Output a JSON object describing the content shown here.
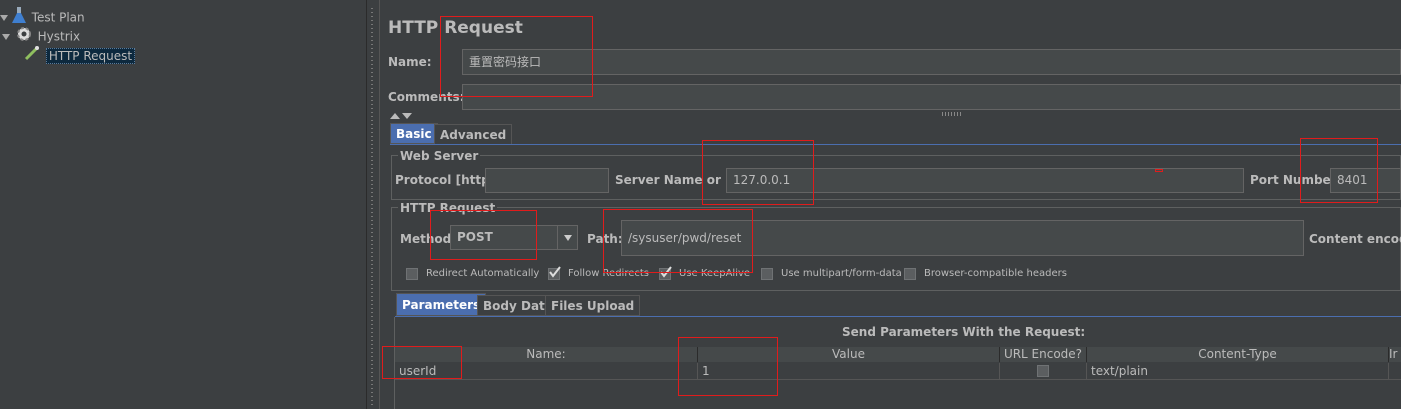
{
  "tree": {
    "items": [
      {
        "label": "Test Plan",
        "icon": "flask-icon"
      },
      {
        "label": "Hystrix",
        "icon": "gear-icon"
      },
      {
        "label": "HTTP Request",
        "icon": "pipette-icon"
      }
    ]
  },
  "editor": {
    "title": "HTTP Request",
    "name_label": "Name:",
    "name_value": "重置密码接口",
    "comments_label": "Comments:",
    "comments_value": "",
    "tabs": [
      "Basic",
      "Advanced"
    ],
    "web_server": {
      "legend": "Web Server",
      "protocol_label": "Protocol [http]:",
      "protocol_value": "",
      "server_label": "Server Name or IP:",
      "server_value": "127.0.0.1",
      "port_label": "Port Number:",
      "port_value": "8401"
    },
    "http_request": {
      "legend": "HTTP Request",
      "method_label": "Method:",
      "method_value": "POST",
      "path_label": "Path:",
      "path_value": "/sysuser/pwd/reset",
      "encoding_label": "Content encodin",
      "checkboxes": [
        {
          "label": "Redirect Automatically",
          "checked": false
        },
        {
          "label": "Follow Redirects",
          "checked": true
        },
        {
          "label": "Use KeepAlive",
          "checked": true
        },
        {
          "label": "Use multipart/form-data",
          "checked": false
        },
        {
          "label": "Browser-compatible headers",
          "checked": false
        }
      ]
    },
    "param_tabs": [
      "Parameters",
      "Body Data",
      "Files Upload"
    ],
    "params": {
      "heading": "Send Parameters With the Request:",
      "columns": [
        "Name:",
        "Value",
        "URL Encode?",
        "Content-Type",
        "Ir"
      ],
      "rows": [
        {
          "name": "userId",
          "value": "1",
          "url_encode": false,
          "content_type": "text/plain"
        }
      ]
    }
  },
  "colors": {
    "accent": "#4b6eaf",
    "highlight_box": "#e01c1c",
    "background": "#3c3f41"
  }
}
